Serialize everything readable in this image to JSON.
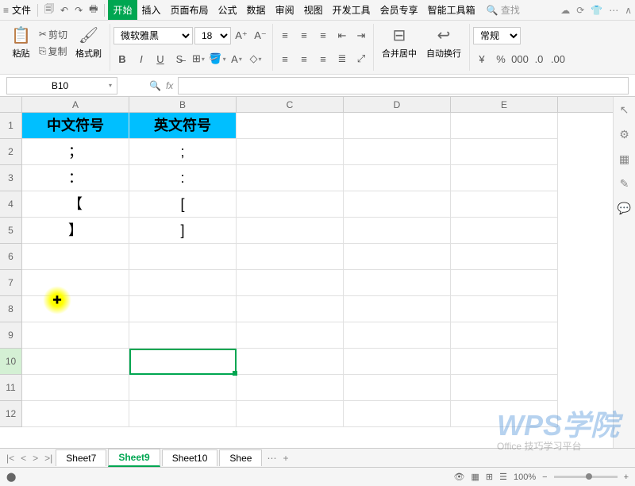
{
  "menu": {
    "file": "文件",
    "tabs": [
      "开始",
      "插入",
      "页面布局",
      "公式",
      "数据",
      "审阅",
      "视图",
      "开发工具",
      "会员专享",
      "智能工具箱"
    ],
    "active_tab": 0,
    "search": "查找"
  },
  "toolbar": {
    "paste": "粘贴",
    "cut": "剪切",
    "copy": "复制",
    "format_painter": "格式刷",
    "font_name": "微软雅黑",
    "font_size": "18",
    "merge": "合并居中",
    "wrap": "自动换行",
    "format": "常规",
    "currency": "¥",
    "percent": "%"
  },
  "formula_bar": {
    "cell_ref": "B10",
    "fx": "fx",
    "formula": ""
  },
  "columns": [
    "A",
    "B",
    "C",
    "D",
    "E"
  ],
  "rows": [
    1,
    2,
    3,
    4,
    5,
    6,
    7,
    8,
    9,
    10,
    11,
    12
  ],
  "chart_data": {
    "type": "table",
    "headers": [
      "中文符号",
      "英文符号"
    ],
    "rows": [
      [
        "；",
        ";"
      ],
      [
        "：",
        ":"
      ],
      [
        "【",
        "["
      ],
      [
        "】",
        "]"
      ]
    ]
  },
  "sheet_tabs": [
    "Sheet7",
    "Sheet9",
    "Sheet10",
    "Shee"
  ],
  "active_sheet": 1,
  "status": {
    "zoom": "100%"
  },
  "watermark": {
    "logo": "WPS学院",
    "sub": "Office 技巧学习平台"
  }
}
